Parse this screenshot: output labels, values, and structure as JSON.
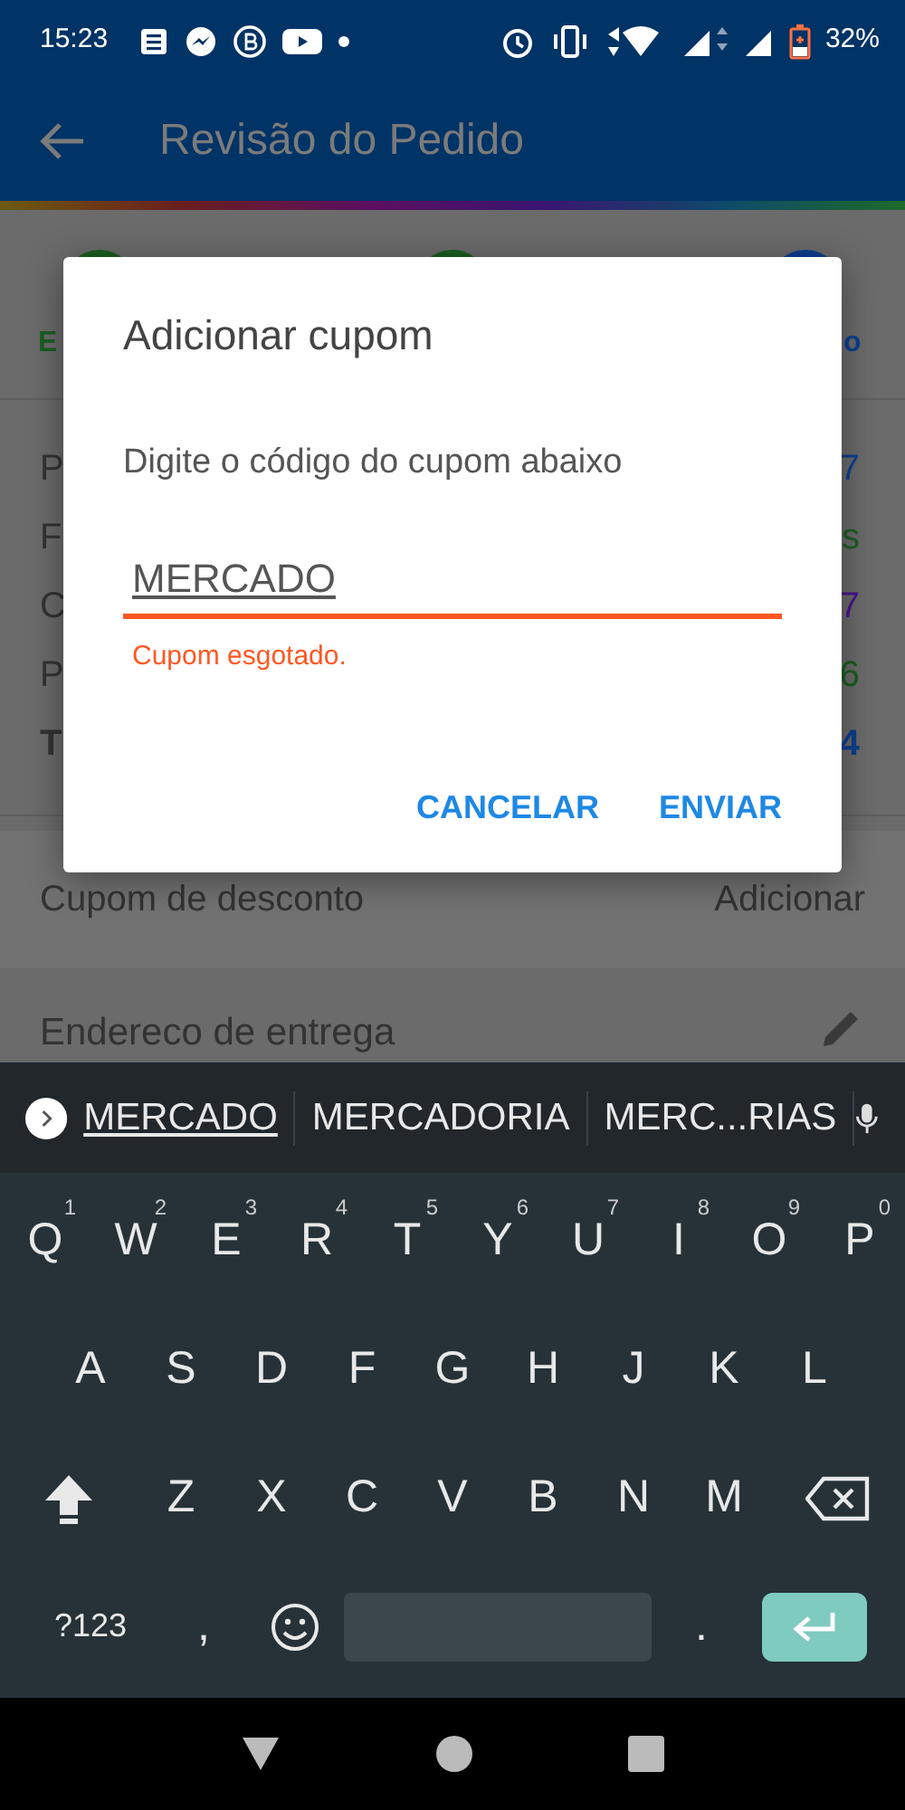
{
  "status_bar": {
    "time": "15:23",
    "battery": "32%"
  },
  "app_bar": {
    "title": "Revisão do Pedido"
  },
  "steps": [
    {
      "label": "E",
      "color": "#1b5e20"
    },
    {
      "color": "#1b5e20"
    },
    {
      "label": "o",
      "color": "#0d3f8f"
    }
  ],
  "summary_rows": [
    {
      "label": "P",
      "value": "7",
      "color": "#0d3f8f",
      "kind": "line"
    },
    {
      "label": "F",
      "value": "s",
      "color": "#1b5e20",
      "kind": "line"
    },
    {
      "label": "C",
      "value": "7",
      "color": "#4a148c",
      "kind": "line"
    },
    {
      "label": "P",
      "value": "6",
      "color": "#1b5e20",
      "kind": "line"
    },
    {
      "label": "T",
      "value": "4",
      "color": "#0d3f8f",
      "kind": "total"
    }
  ],
  "coupon_row": {
    "label": "Cupom de desconto",
    "action": "Adicionar"
  },
  "address": {
    "title": "Endereco de entrega"
  },
  "dialog": {
    "title": "Adicionar cupom",
    "message": "Digite o código do cupom abaixo",
    "field": {
      "value": "MERCADO"
    },
    "error": "Cupom esgotado.",
    "buttons": [
      "CANCELAR",
      "ENVIAR"
    ]
  },
  "keyboard": {
    "suggestions": [
      {
        "text": "MERCADO",
        "selected": true
      },
      {
        "text": "MERCADORIA",
        "selected": false
      },
      {
        "text": "MERC...RIAS",
        "selected": false
      }
    ],
    "rows": [
      [
        {
          "kind": "char",
          "label": "Q",
          "hint": "1"
        },
        {
          "kind": "char",
          "label": "W",
          "hint": "2"
        },
        {
          "kind": "char",
          "label": "E",
          "hint": "3"
        },
        {
          "kind": "char",
          "label": "R",
          "hint": "4"
        },
        {
          "kind": "char",
          "label": "T",
          "hint": "5"
        },
        {
          "kind": "char",
          "label": "Y",
          "hint": "6"
        },
        {
          "kind": "char",
          "label": "U",
          "hint": "7"
        },
        {
          "kind": "char",
          "label": "I",
          "hint": "8"
        },
        {
          "kind": "char",
          "label": "O",
          "hint": "9"
        },
        {
          "kind": "char",
          "label": "P",
          "hint": "0"
        }
      ],
      [
        {
          "kind": "char",
          "label": "A"
        },
        {
          "kind": "char",
          "label": "S"
        },
        {
          "kind": "char",
          "label": "D"
        },
        {
          "kind": "char",
          "label": "F"
        },
        {
          "kind": "char",
          "label": "G"
        },
        {
          "kind": "char",
          "label": "H"
        },
        {
          "kind": "char",
          "label": "J"
        },
        {
          "kind": "char",
          "label": "K"
        },
        {
          "kind": "char",
          "label": "L"
        }
      ],
      [
        {
          "kind": "shift"
        },
        {
          "kind": "char",
          "label": "Z"
        },
        {
          "kind": "char",
          "label": "X"
        },
        {
          "kind": "char",
          "label": "C"
        },
        {
          "kind": "char",
          "label": "V"
        },
        {
          "kind": "char",
          "label": "B"
        },
        {
          "kind": "char",
          "label": "N"
        },
        {
          "kind": "char",
          "label": "M"
        },
        {
          "kind": "backspace"
        }
      ],
      [
        {
          "kind": "mode",
          "label": "?123"
        },
        {
          "kind": "char",
          "label": ","
        },
        {
          "kind": "emoji"
        },
        {
          "kind": "space"
        },
        {
          "kind": "char",
          "label": "."
        },
        {
          "kind": "enter"
        }
      ]
    ]
  }
}
